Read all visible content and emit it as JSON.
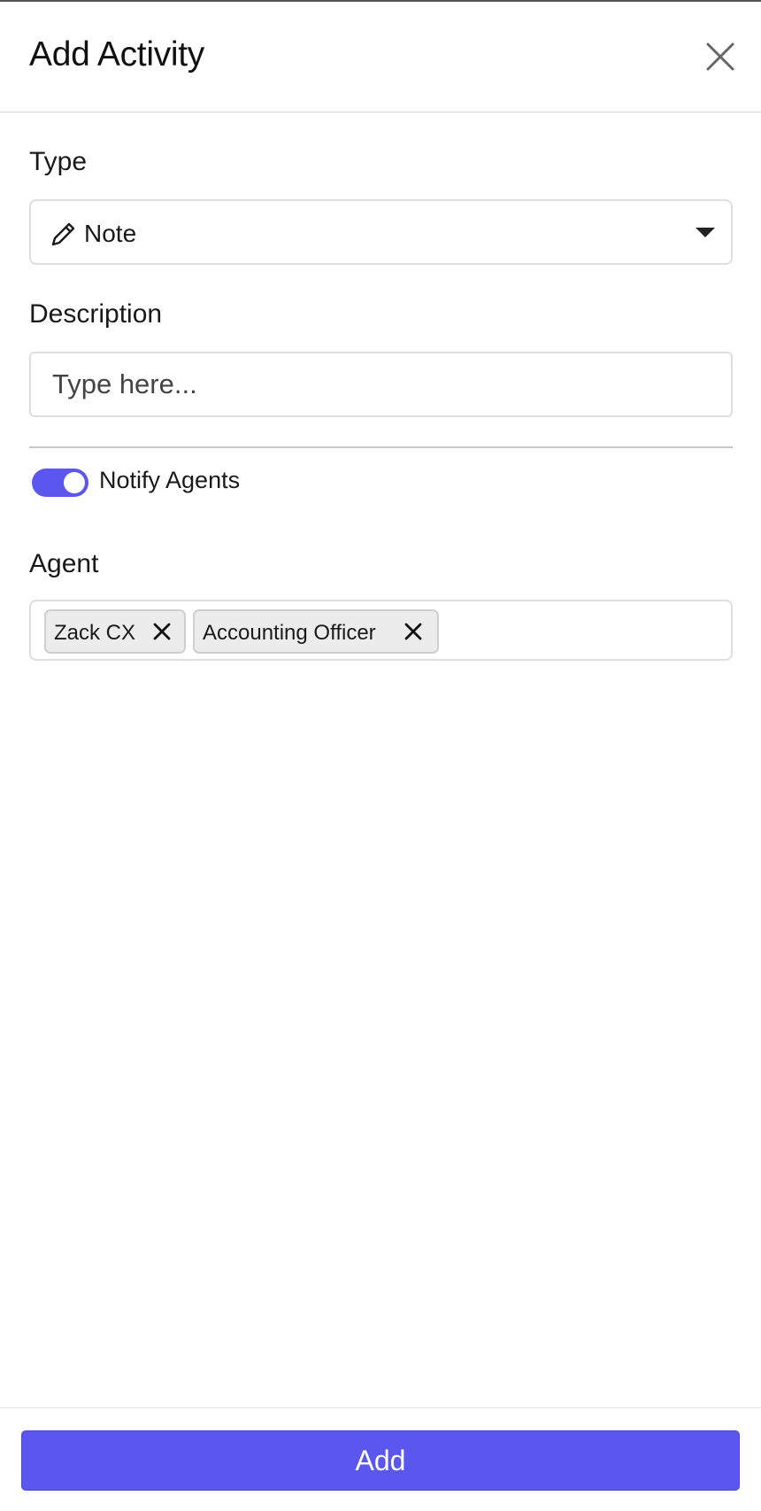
{
  "dialog": {
    "title": "Add Activity"
  },
  "form": {
    "type": {
      "label": "Type",
      "selected_value": "Note",
      "icon": "pencil-icon"
    },
    "description": {
      "label": "Description",
      "placeholder": "Type here...",
      "value": ""
    },
    "notify": {
      "label": "Notify Agents",
      "enabled": true
    },
    "agent": {
      "label": "Agent",
      "selected": [
        {
          "label": "Zack CX"
        },
        {
          "label": "Accounting Officer"
        }
      ]
    }
  },
  "footer": {
    "add_label": "Add"
  },
  "colors": {
    "accent": "#5b57ee",
    "border": "#dedede",
    "tag_background": "#ececec"
  }
}
